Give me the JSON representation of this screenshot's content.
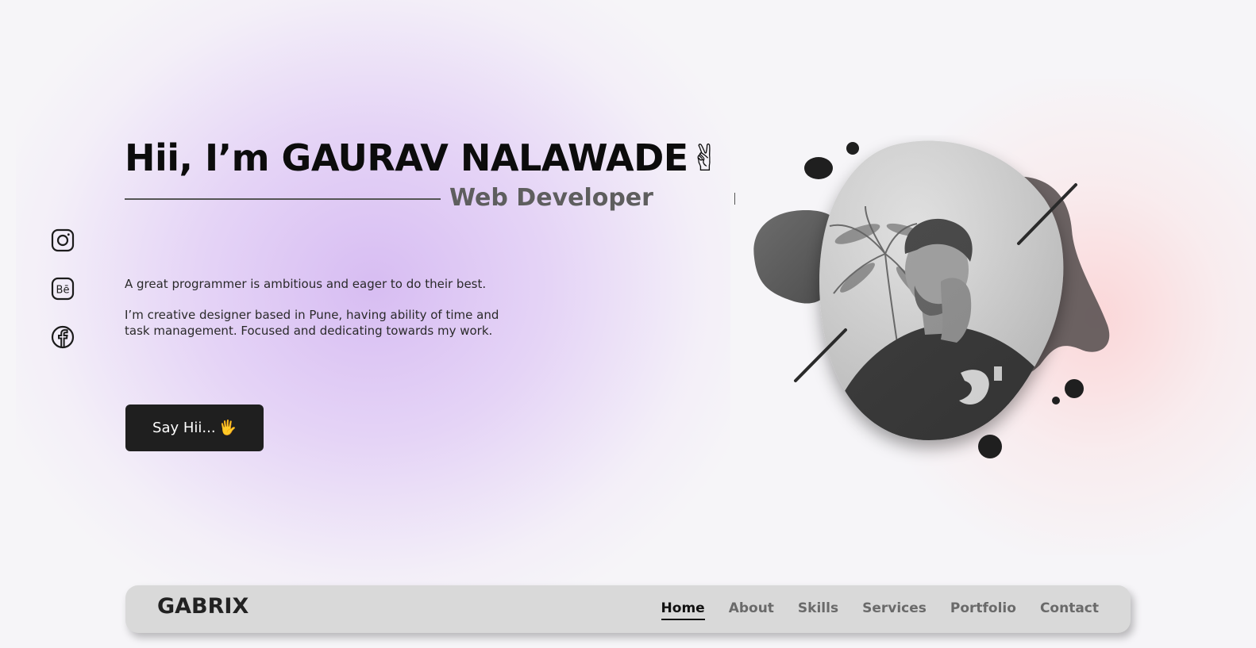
{
  "hero": {
    "title": "Hii, I’m GAURAV NALAWADE",
    "title_emoji": "✌",
    "role": "Web Developer",
    "paragraph_1": "A great programmer is ambitious and eager to do their best.",
    "paragraph_2": "I’m creative designer based in Pune, having ability of time and task management. Focused and dedicating towards my work.",
    "cta_label": "Say Hii...",
    "cta_emoji": "🖐"
  },
  "socials": [
    {
      "icon": "instagram-icon"
    },
    {
      "icon": "behance-icon"
    },
    {
      "icon": "facebook-icon"
    }
  ],
  "navbar": {
    "brand": "GABRIX",
    "links": [
      "Home",
      "About",
      "Skills",
      "Services",
      "Portfolio",
      "Contact"
    ],
    "active": "Home"
  },
  "colors": {
    "background": "#f6f5f8",
    "accent_purple": "#d7bcf2",
    "accent_pink": "#ffcaca",
    "button": "#1f1f1f",
    "navbar": "#d9d9d9"
  }
}
